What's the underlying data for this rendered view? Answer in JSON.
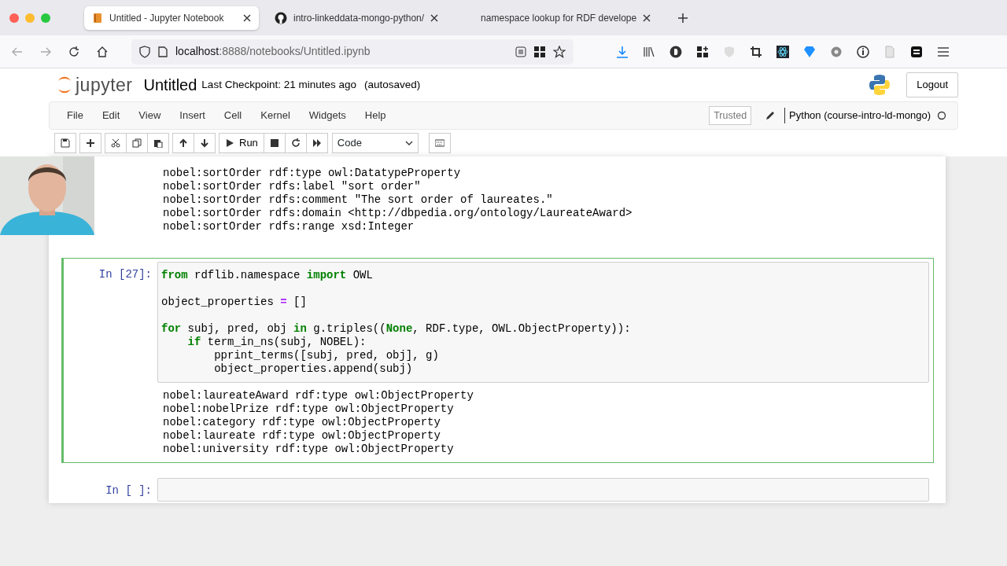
{
  "browser": {
    "tabs": [
      {
        "title": "Untitled - Jupyter Notebook",
        "selected": true
      },
      {
        "title": "intro-linkeddata-mongo-python/",
        "selected": false
      },
      {
        "title": "namespace lookup for RDF develope",
        "selected": false
      }
    ],
    "url": {
      "host": "localhost",
      "path": ":8888/notebooks/Untitled.ipynb"
    }
  },
  "header": {
    "logo_text": "jupyter",
    "notebook_name": "Untitled",
    "checkpoint": "Last Checkpoint: 21 minutes ago",
    "autosave": "(autosaved)",
    "logout": "Logout"
  },
  "menus": [
    "File",
    "Edit",
    "View",
    "Insert",
    "Cell",
    "Kernel",
    "Widgets",
    "Help"
  ],
  "kernel": {
    "trusted": "Trusted",
    "name": "Python (course-intro-ld-mongo)",
    "busy": false
  },
  "toolbar": {
    "run_label": "Run",
    "cell_type": "Code"
  },
  "cells": [
    {
      "kind": "output",
      "output": [
        "nobel:sortOrder rdf:type owl:DatatypeProperty",
        "nobel:sortOrder rdfs:label \"sort order\"",
        "nobel:sortOrder rdfs:comment \"The sort order of laureates.\"",
        "nobel:sortOrder rdfs:domain <http://dbpedia.org/ontology/LaureateAward>",
        "nobel:sortOrder rdfs:range xsd:Integer"
      ]
    },
    {
      "kind": "code",
      "prompt": "In [27]:",
      "selected": true,
      "lines": [
        {
          "kind": "code",
          "segments": [
            {
              "text": "from",
              "kind": "kw"
            },
            {
              "text": " rdflib.namespace ",
              "kind": "plain"
            },
            {
              "text": "import",
              "kind": "kw"
            },
            {
              "text": " OWL",
              "kind": "plain"
            }
          ]
        },
        {
          "kind": "blank"
        },
        {
          "kind": "code",
          "segments": [
            {
              "text": "object_properties ",
              "kind": "plain"
            },
            {
              "text": "=",
              "kind": "op"
            },
            {
              "text": " []",
              "kind": "plain"
            }
          ]
        },
        {
          "kind": "blank"
        },
        {
          "kind": "code",
          "segments": [
            {
              "text": "for",
              "kind": "kw"
            },
            {
              "text": " subj, pred, obj ",
              "kind": "plain"
            },
            {
              "text": "in",
              "kind": "kw"
            },
            {
              "text": " g.triples((",
              "kind": "plain"
            },
            {
              "text": "None",
              "kind": "kw"
            },
            {
              "text": ", RDF.type, OWL.ObjectProperty)):",
              "kind": "plain"
            }
          ]
        },
        {
          "kind": "code",
          "segments": [
            {
              "text": "    if",
              "kind": "kw"
            },
            {
              "text": " term_in_ns(subj, NOBEL):",
              "kind": "plain"
            }
          ]
        },
        {
          "kind": "code",
          "segments": [
            {
              "text": "        pprint_terms([subj, pred, obj], g)",
              "kind": "plain"
            }
          ]
        },
        {
          "kind": "code",
          "segments": [
            {
              "text": "        object_properties.append(subj)",
              "kind": "plain"
            }
          ]
        }
      ],
      "output": [
        "nobel:laureateAward rdf:type owl:ObjectProperty",
        "nobel:nobelPrize rdf:type owl:ObjectProperty",
        "nobel:category rdf:type owl:ObjectProperty",
        "nobel:laureate rdf:type owl:ObjectProperty",
        "nobel:university rdf:type owl:ObjectProperty"
      ]
    },
    {
      "kind": "code",
      "prompt": "In [ ]:",
      "selected": false
    }
  ]
}
